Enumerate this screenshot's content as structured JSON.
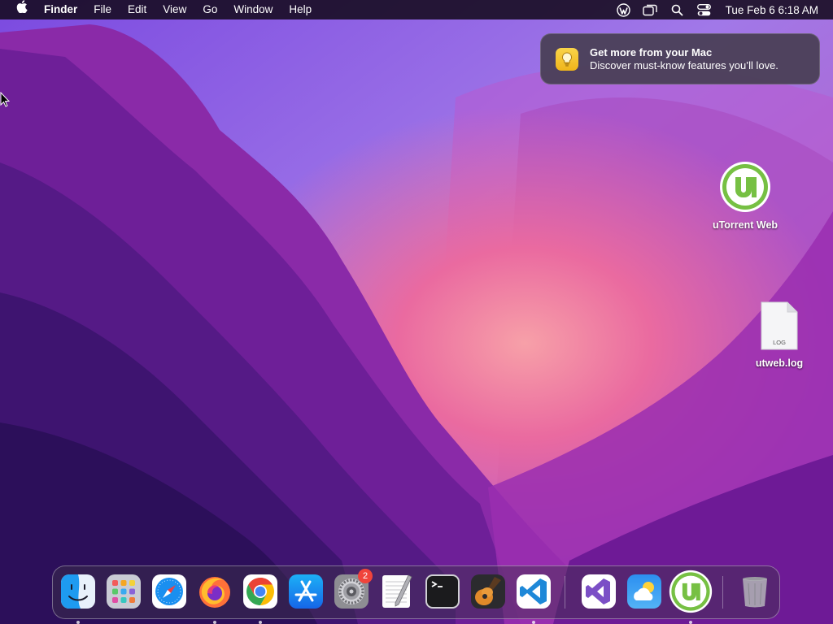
{
  "menubar": {
    "apple_icon": "apple-logo-icon",
    "app_name": "Finder",
    "items": [
      "File",
      "Edit",
      "View",
      "Go",
      "Window",
      "Help"
    ],
    "status_icons": [
      "wordpress-icon",
      "screen-mirroring-icon",
      "spotlight-search-icon",
      "control-center-icon"
    ],
    "clock": "Tue Feb 6  6:18 AM"
  },
  "notification": {
    "icon": "lightbulb-icon",
    "title": "Get more from your Mac",
    "body": "Discover must-know features you’ll love."
  },
  "desktop_items": [
    {
      "label": "uTorrent Web",
      "icon": "utorrent-icon"
    },
    {
      "label": "utweb.log",
      "icon": "log-file-icon",
      "file_badge": "LOG"
    }
  ],
  "dock": {
    "apps": [
      {
        "name": "Finder",
        "icon": "finder-icon",
        "running": true
      },
      {
        "name": "Launchpad",
        "icon": "launchpad-icon",
        "running": false
      },
      {
        "name": "Safari",
        "icon": "safari-icon",
        "running": false
      },
      {
        "name": "Firefox",
        "icon": "firefox-icon",
        "running": true
      },
      {
        "name": "Google Chrome",
        "icon": "chrome-icon",
        "running": true
      },
      {
        "name": "App Store",
        "icon": "app-store-icon",
        "running": false
      },
      {
        "name": "System Settings",
        "icon": "system-settings-icon",
        "running": false,
        "badge": "2"
      },
      {
        "name": "TextEdit",
        "icon": "textedit-icon",
        "running": false
      },
      {
        "name": "Terminal",
        "icon": "terminal-icon",
        "running": false
      },
      {
        "name": "GarageBand",
        "icon": "garageband-icon",
        "running": false
      },
      {
        "name": "Visual Studio Code",
        "icon": "vscode-icon",
        "running": true
      }
    ],
    "recent_apps": [
      {
        "name": "Visual Studio",
        "icon": "visual-studio-icon",
        "running": false
      },
      {
        "name": "Weather",
        "icon": "weather-icon",
        "running": false
      },
      {
        "name": "uTorrent Web",
        "icon": "utorrent-icon",
        "running": true
      }
    ],
    "trash": {
      "name": "Trash",
      "icon": "trash-icon"
    }
  },
  "colors": {
    "menubar_bg": "#140a1e",
    "wallpaper_primary": "#7a2fb8",
    "wallpaper_glow": "#f07aa0",
    "badge_red": "#f0443b",
    "utorrent_green": "#76c043"
  }
}
